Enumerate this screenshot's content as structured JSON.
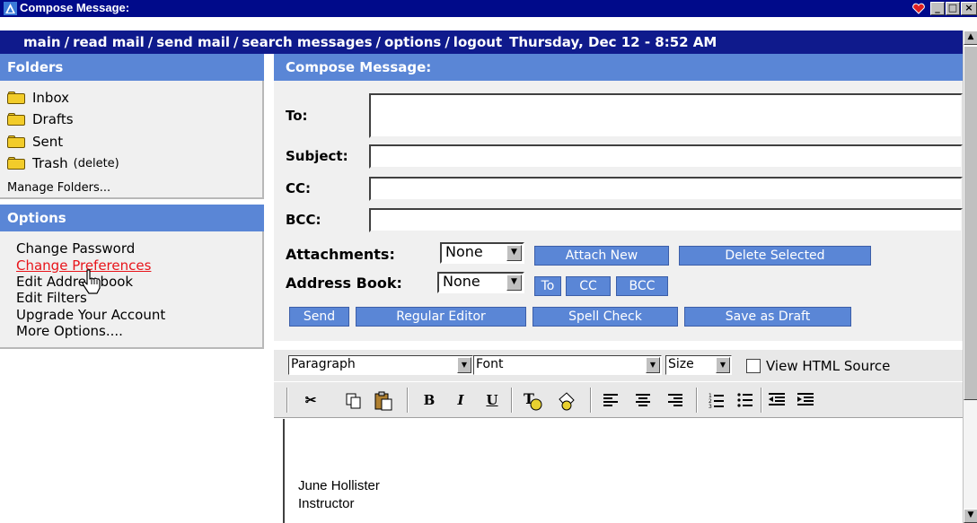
{
  "window": {
    "title": "Compose Message:"
  },
  "nav": {
    "items": [
      "main",
      "read mail",
      "send mail",
      "search messages",
      "options",
      "logout"
    ],
    "separator": "/",
    "datetime": "Thursday, Dec 12 - 8:52 AM"
  },
  "folders": {
    "heading": "Folders",
    "items": [
      {
        "label": "Inbox",
        "extra": ""
      },
      {
        "label": "Drafts",
        "extra": ""
      },
      {
        "label": "Sent",
        "extra": ""
      },
      {
        "label": "Trash",
        "extra": "(delete)"
      }
    ],
    "manage_label": "Manage Folders..."
  },
  "options": {
    "heading": "Options",
    "items": [
      "Change Password",
      "Change Preferences",
      "Edit Addressbook",
      "Edit Filters",
      "Upgrade Your Account",
      "More Options...."
    ],
    "active_index": 1
  },
  "compose": {
    "heading": "Compose Message:",
    "fields": {
      "to": "To:",
      "subject": "Subject:",
      "cc": "CC:",
      "bcc": "BCC:"
    },
    "values": {
      "to": "",
      "subject": "",
      "cc": "",
      "bcc": ""
    },
    "attachments_label": "Attachments:",
    "attachments_select": "None",
    "attach_new": "Attach New",
    "delete_selected": "Delete Selected",
    "addressbook_label": "Address Book:",
    "addressbook_select": "None",
    "ab_to": "To",
    "ab_cc": "CC",
    "ab_bcc": "BCC",
    "send": "Send",
    "regular_editor": "Regular Editor",
    "spell_check": "Spell Check",
    "save_draft": "Save as Draft"
  },
  "editor": {
    "paragraph": "Paragraph",
    "font": "Font",
    "size": "Size",
    "view_html_label": "View HTML Source",
    "view_html_checked": false,
    "bold": "B",
    "italic": "I",
    "underline": "U",
    "signature_line1": "June Hollister",
    "signature_line2": "Instructor"
  },
  "colors": {
    "title_bar": "#000a8a",
    "nav_bar": "#0f1a8c",
    "panel_header": "#5a86d6",
    "active_link": "#e8141a"
  }
}
